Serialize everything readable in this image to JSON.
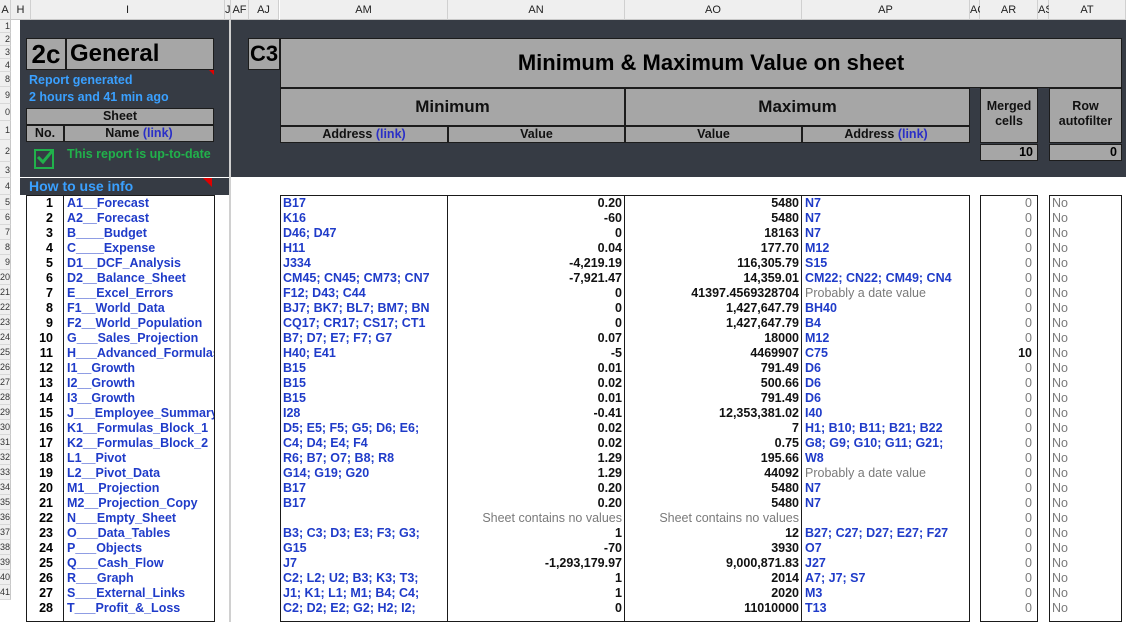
{
  "columns": [
    {
      "id": "corner",
      "label": "A"
    },
    {
      "id": "H",
      "label": "H"
    },
    {
      "id": "I",
      "label": "I"
    },
    {
      "id": "J",
      "label": "J"
    },
    {
      "id": "AF",
      "label": "AF"
    },
    {
      "id": "AJ",
      "label": "AJ"
    },
    {
      "id": "AM",
      "label": "AM"
    },
    {
      "id": "AN",
      "label": "AN"
    },
    {
      "id": "AO",
      "label": "AO"
    },
    {
      "id": "AP",
      "label": "AP"
    },
    {
      "id": "AQ",
      "label": "AQ"
    },
    {
      "id": "AR",
      "label": "AR"
    },
    {
      "id": "AS",
      "label": "AS"
    },
    {
      "id": "AT",
      "label": "AT"
    }
  ],
  "row_numbers": [
    "1",
    "2",
    "3",
    "4",
    "8",
    "9",
    "0",
    "1",
    "2",
    "3",
    "4",
    "5",
    "6",
    "7",
    "8",
    "9",
    "20",
    "21",
    "22",
    "23",
    "24",
    "25",
    "26",
    "27",
    "28",
    "29",
    "30",
    "31",
    "32",
    "33",
    "34",
    "35",
    "36",
    "37",
    "38",
    "39",
    "40",
    "41"
  ],
  "left_panel": {
    "section_code": "2c",
    "section_title": "General",
    "report_line1": "Report generated",
    "report_line2": "2 hours and 41 min ago",
    "sheet_header": "Sheet",
    "col_no": "No.",
    "col_name": "Name",
    "link_text": "(link)",
    "status_text": "This report is up-to-date",
    "how_to": "How to use info"
  },
  "right_panel": {
    "section_code": "C3",
    "title": "Minimum & Maximum Value on sheet",
    "minimum": "Minimum",
    "maximum": "Maximum",
    "address": "Address",
    "value": "Value",
    "link_text": "(link)",
    "merged_cells": "Merged cells",
    "row_autofilter": "Row autofilter",
    "merged_total": "10",
    "autofilter_total": "0"
  },
  "sheets": [
    {
      "no": "1",
      "name": "A1__Forecast",
      "min_addr": "B17",
      "min_val": "0.20",
      "max_val": "5480",
      "max_addr": "N7",
      "merged": "0",
      "af": "No"
    },
    {
      "no": "2",
      "name": "A2__Forecast",
      "min_addr": "K16",
      "min_val": "-60",
      "max_val": "5480",
      "max_addr": "N7",
      "merged": "0",
      "af": "No"
    },
    {
      "no": "3",
      "name": "B____Budget",
      "min_addr": "D46; D47",
      "min_val": "0",
      "max_val": "18163",
      "max_addr": "N7",
      "merged": "0",
      "af": "No"
    },
    {
      "no": "4",
      "name": "C____Expense",
      "min_addr": "H11",
      "min_val": "0.04",
      "max_val": "177.70",
      "max_addr": "M12",
      "merged": "0",
      "af": "No"
    },
    {
      "no": "5",
      "name": "D1__DCF_Analysis",
      "min_addr": "J334",
      "min_val": "-4,219.19",
      "max_val": "116,305.79",
      "max_addr": "S15",
      "merged": "0",
      "af": "No"
    },
    {
      "no": "6",
      "name": "D2__Balance_Sheet",
      "min_addr": "CM45; CN45; CM73; CN7",
      "min_val": "-7,921.47",
      "max_val": "14,359.01",
      "max_addr": "CM22; CN22; CM49; CN4",
      "merged": "0",
      "af": "No"
    },
    {
      "no": "7",
      "name": "E___Excel_Errors",
      "min_addr": "F12; D43; C44",
      "min_val": "0",
      "max_val": "41397.4569328704",
      "max_addr": "Probably a date value",
      "max_gray": true,
      "merged": "0",
      "af": "No"
    },
    {
      "no": "8",
      "name": "F1__World_Data",
      "min_addr": "BJ7; BK7; BL7; BM7; BN",
      "min_val": "0",
      "max_val": "1,427,647.79",
      "max_addr": "BH40",
      "merged": "0",
      "af": "No"
    },
    {
      "no": "9",
      "name": "F2__World_Population",
      "min_addr": "CQ17; CR17; CS17; CT1",
      "min_val": "0",
      "max_val": "1,427,647.79",
      "max_addr": "B4",
      "merged": "0",
      "af": "No"
    },
    {
      "no": "10",
      "name": "G___Sales_Projection",
      "min_addr": "B7; D7; E7; F7; G7",
      "min_val": "0.07",
      "max_val": "18000",
      "max_addr": "M12",
      "merged": "0",
      "af": "No"
    },
    {
      "no": "11",
      "name": "H___Advanced_Formulas",
      "min_addr": "H40; E41",
      "min_val": "-5",
      "max_val": "4469907",
      "max_addr": "C75",
      "merged": "10",
      "af": "No"
    },
    {
      "no": "12",
      "name": "I1__Growth",
      "min_addr": "B15",
      "min_val": "0.01",
      "max_val": "791.49",
      "max_addr": "D6",
      "merged": "0",
      "af": "No"
    },
    {
      "no": "13",
      "name": "I2__Growth",
      "min_addr": "B15",
      "min_val": "0.02",
      "max_val": "500.66",
      "max_addr": "D6",
      "merged": "0",
      "af": "No"
    },
    {
      "no": "14",
      "name": "I3__Growth",
      "min_addr": "B15",
      "min_val": "0.01",
      "max_val": "791.49",
      "max_addr": "D6",
      "merged": "0",
      "af": "No"
    },
    {
      "no": "15",
      "name": "J___Employee_Summary",
      "min_addr": "I28",
      "min_val": "-0.41",
      "max_val": "12,353,381.02",
      "max_addr": "I40",
      "merged": "0",
      "af": "No"
    },
    {
      "no": "16",
      "name": "K1__Formulas_Block_1",
      "min_addr": "D5; E5; F5; G5; D6; E6;",
      "min_val": "0.02",
      "max_val": "7",
      "max_addr": "H1; B10; B11; B21; B22",
      "merged": "0",
      "af": "No"
    },
    {
      "no": "17",
      "name": "K2__Formulas_Block_2",
      "min_addr": "C4; D4; E4; F4",
      "min_val": "0.02",
      "max_val": "0.75",
      "max_addr": "G8; G9; G10; G11; G21;",
      "merged": "0",
      "af": "No"
    },
    {
      "no": "18",
      "name": "L1__Pivot",
      "min_addr": "R6; B7; O7; B8; R8",
      "min_val": "1.29",
      "max_val": "195.66",
      "max_addr": "W8",
      "merged": "0",
      "af": "No"
    },
    {
      "no": "19",
      "name": "L2__Pivot_Data",
      "min_addr": "G14; G19; G20",
      "min_val": "1.29",
      "max_val": "44092",
      "max_addr": "Probably a date value",
      "max_gray": true,
      "merged": "0",
      "af": "No"
    },
    {
      "no": "20",
      "name": "M1__Projection",
      "min_addr": "B17",
      "min_val": "0.20",
      "max_val": "5480",
      "max_addr": "N7",
      "merged": "0",
      "af": "No"
    },
    {
      "no": "21",
      "name": "M2__Projection_Copy",
      "min_addr": "B17",
      "min_val": "0.20",
      "max_val": "5480",
      "max_addr": "N7",
      "merged": "0",
      "af": "No"
    },
    {
      "no": "22",
      "name": "N___Empty_Sheet",
      "min_addr": "",
      "min_val": "Sheet contains no values",
      "min_gray": true,
      "max_val": "Sheet contains no values",
      "max_gray_val": true,
      "max_addr": "",
      "merged": "0",
      "af": "No"
    },
    {
      "no": "23",
      "name": "O___Data_Tables",
      "min_addr": "B3; C3; D3; E3; F3; G3;",
      "min_val": "1",
      "max_val": "12",
      "max_addr": "B27; C27; D27; E27; F27",
      "merged": "0",
      "af": "No"
    },
    {
      "no": "24",
      "name": "P___Objects",
      "min_addr": "G15",
      "min_val": "-70",
      "max_val": "3930",
      "max_addr": "O7",
      "merged": "0",
      "af": "No"
    },
    {
      "no": "25",
      "name": "Q___Cash_Flow",
      "min_addr": "J7",
      "min_val": "-1,293,179.97",
      "max_val": "9,000,871.83",
      "max_addr": "J27",
      "merged": "0",
      "af": "No"
    },
    {
      "no": "26",
      "name": "R___Graph",
      "min_addr": "C2; L2; U2; B3; K3; T3;",
      "min_val": "1",
      "max_val": "2014",
      "max_addr": "A7; J7; S7",
      "merged": "0",
      "af": "No"
    },
    {
      "no": "27",
      "name": "S___External_Links",
      "min_addr": "J1; K1; L1; M1; B4; C4;",
      "min_val": "1",
      "max_val": "2020",
      "max_addr": "M3",
      "merged": "0",
      "af": "No"
    },
    {
      "no": "28",
      "name": "T___Profit_&_Loss",
      "min_addr": "C2; D2; E2; G2; H2; I2;",
      "min_val": "0",
      "max_val": "11010000",
      "max_addr": "T13",
      "merged": "0",
      "af": "No"
    }
  ]
}
